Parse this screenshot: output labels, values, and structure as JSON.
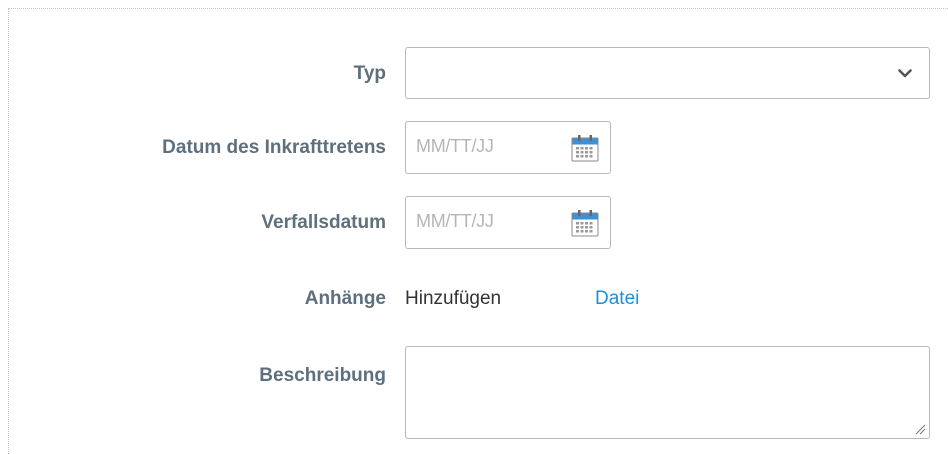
{
  "form": {
    "type": {
      "label": "Typ",
      "value": ""
    },
    "effective_date": {
      "label": "Datum des Inkrafttretens",
      "placeholder": "MM/TT/JJ"
    },
    "expiry_date": {
      "label": "Verfallsdatum",
      "placeholder": "MM/TT/JJ"
    },
    "attachments": {
      "label": "Anhänge",
      "add_text": "Hinzufügen",
      "file_link": "Datei"
    },
    "description": {
      "label": "Beschreibung",
      "value": ""
    }
  },
  "colors": {
    "label": "#5e6f7d",
    "link": "#1f8fd6",
    "border": "#b8b8b8",
    "placeholder": "#b5b5b5"
  },
  "icons": {
    "select": "chevron-down-icon",
    "date_picker": "calendar-icon",
    "resize": "resize-grip-icon"
  }
}
